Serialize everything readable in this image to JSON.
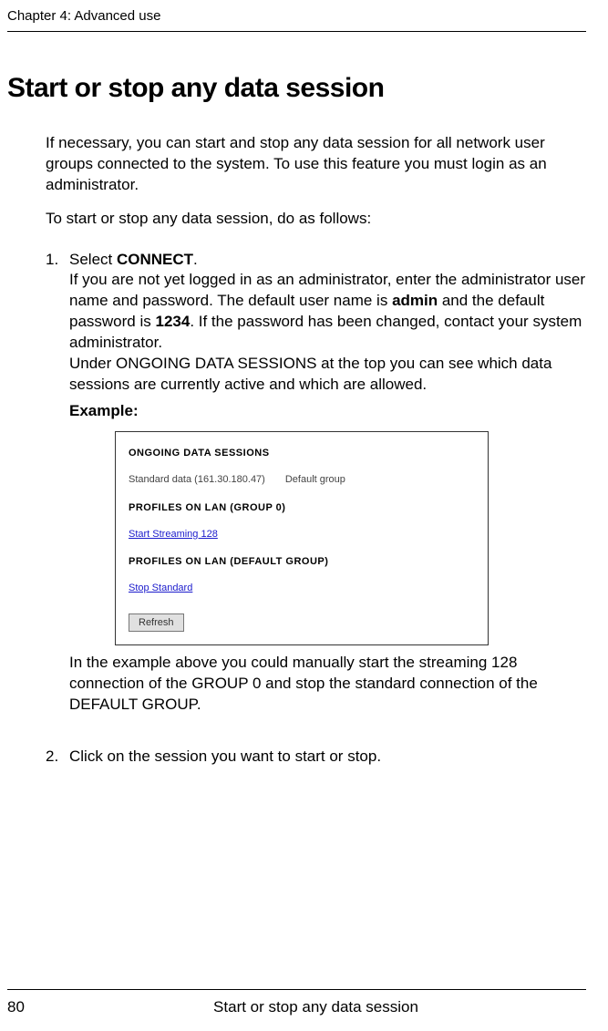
{
  "chapter_header": "Chapter 4:  Advanced use",
  "section_title": "Start or stop any data session",
  "intro_para": "If necessary, you can start and stop any data session for all network user groups connected to the system. To use this feature you must login as an administrator.",
  "lead_para": "To start or stop any data session, do as follows:",
  "steps": [
    {
      "number": "1.",
      "head_text": "Select ",
      "head_bold": "CONNECT",
      "head_after": ".",
      "para2_a": "If you are not yet logged in as an administrator, enter the administrator user name and password. The default user name is ",
      "para2_bold1": "admin",
      "para2_b": " and the default password is ",
      "para2_bold2": "1234",
      "para2_c": ". If the password has been changed, contact your system administrator.",
      "para3": "Under ONGOING DATA SESSIONS at the top you can see which data sessions are currently active and which are allowed.",
      "example_label": "Example",
      "after_shot": "In the example above you could manually start the streaming 128 connection of the GROUP 0 and stop the standard connection of the DEFAULT GROUP."
    },
    {
      "number": "2.",
      "text": "Click on the session you want to start or stop."
    }
  ],
  "screenshot": {
    "heading1": "ONGOING DATA SESSIONS",
    "row_data": "Standard data (161.30.180.47)",
    "row_group": "Default group",
    "heading2": "PROFILES ON LAN (GROUP 0)",
    "link1": "Start Streaming 128",
    "heading3": "PROFILES ON LAN (DEFAULT GROUP)",
    "link2": "Stop Standard",
    "button": "Refresh"
  },
  "footer": {
    "page": "80",
    "title": "Start or stop any data session"
  }
}
